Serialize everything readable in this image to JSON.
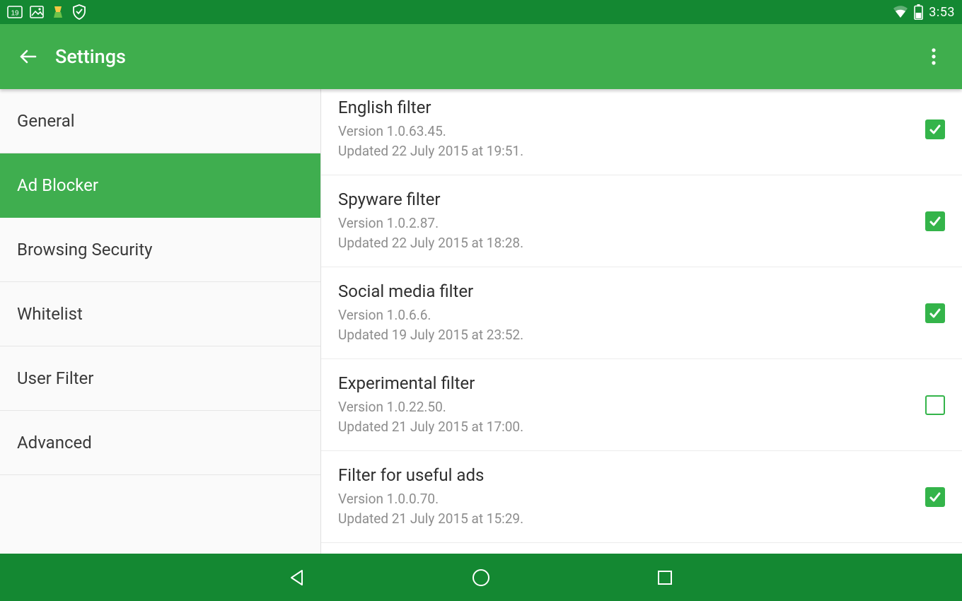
{
  "status": {
    "date_badge": "19",
    "time": "3:53"
  },
  "appbar": {
    "title": "Settings"
  },
  "sidebar": {
    "items": [
      {
        "label": "General"
      },
      {
        "label": "Ad Blocker"
      },
      {
        "label": "Browsing Security"
      },
      {
        "label": "Whitelist"
      },
      {
        "label": "User Filter"
      },
      {
        "label": "Advanced"
      }
    ],
    "active_index": 1
  },
  "filters": [
    {
      "title": "English filter",
      "version": "Version 1.0.63.45.",
      "updated": "Updated 22 July 2015 at 19:51.",
      "checked": true
    },
    {
      "title": "Spyware filter",
      "version": "Version 1.0.2.87.",
      "updated": "Updated 22 July 2015 at 18:28.",
      "checked": true
    },
    {
      "title": "Social media filter",
      "version": "Version 1.0.6.6.",
      "updated": "Updated 19 July 2015 at 23:52.",
      "checked": true
    },
    {
      "title": "Experimental filter",
      "version": "Version 1.0.22.50.",
      "updated": "Updated 21 July 2015 at 17:00.",
      "checked": false
    },
    {
      "title": "Filter for useful ads",
      "version": "Version 1.0.0.70.",
      "updated": "Updated 21 July 2015 at 15:29.",
      "checked": true
    }
  ],
  "colors": {
    "status_bg": "#148832",
    "appbar_bg": "#3fae4d",
    "accent": "#34b44a"
  }
}
